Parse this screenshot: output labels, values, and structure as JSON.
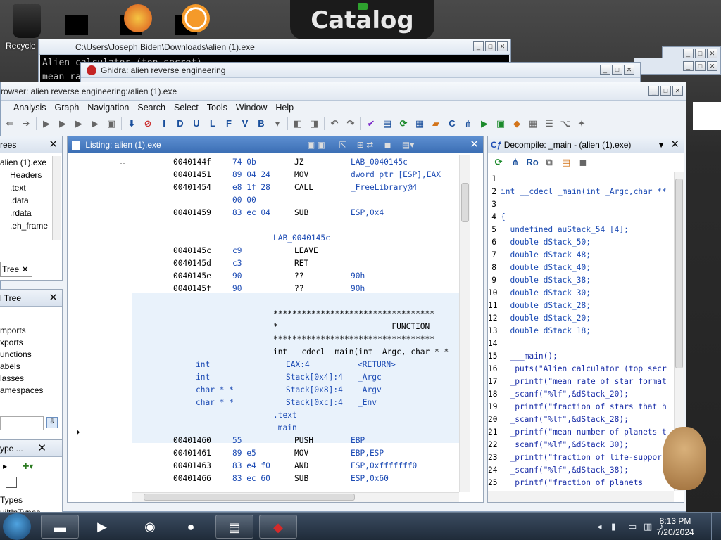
{
  "desktop": {
    "recycle_label": "Recycle",
    "catalog_text": "Catalog"
  },
  "cmd": {
    "title": "C:\\Users\\Joseph Biden\\Downloads\\alien (1).exe",
    "line1": "Alien calculator (top secret)",
    "line2": "mean ra"
  },
  "ghidra_project": {
    "title": "Ghidra: alien reverse engineering"
  },
  "codebrowser": {
    "title": "rowser: alien reverse engineering:/alien (1).exe",
    "menus": [
      "Analysis",
      "Graph",
      "Navigation",
      "Search",
      "Select",
      "Tools",
      "Window",
      "Help"
    ]
  },
  "program_trees": {
    "title": "rees",
    "root": "alien (1).exe",
    "items": [
      "Headers",
      ".text",
      ".data",
      ".rdata",
      ".eh_frame"
    ],
    "tab": "Tree"
  },
  "symbol_tree": {
    "title": "l Tree",
    "items": [
      "mports",
      "xports",
      "unctions",
      "abels",
      "lasses",
      "amespaces"
    ]
  },
  "datatype": {
    "title": "ype ...",
    "items": [
      "Types",
      "uiltInTypes"
    ]
  },
  "listing": {
    "title": "Listing:  alien (1).exe",
    "rows": [
      {
        "addr": "0040144f",
        "bytes": "74 0b",
        "mnem": "JZ",
        "oper": "LAB_0040145c"
      },
      {
        "addr": "00401451",
        "bytes": "89 04 24",
        "mnem": "MOV",
        "oper": "dword ptr [ESP],EAX"
      },
      {
        "addr": "00401454",
        "bytes": "e8 1f 28",
        "mnem": "CALL",
        "oper": "_FreeLibrary@4"
      },
      {
        "addr": "",
        "bytes": "00 00",
        "mnem": "",
        "oper": ""
      },
      {
        "addr": "00401459",
        "bytes": "83 ec 04",
        "mnem": "SUB",
        "oper": "ESP,0x4"
      }
    ],
    "label1": "LAB_0040145c",
    "rows2": [
      {
        "addr": "0040145c",
        "bytes": "c9",
        "mnem": "LEAVE",
        "oper": ""
      },
      {
        "addr": "0040145d",
        "bytes": "c3",
        "mnem": "RET",
        "oper": ""
      },
      {
        "addr": "0040145e",
        "bytes": "90",
        "mnem": "??",
        "oper": "90h"
      },
      {
        "addr": "0040145f",
        "bytes": "90",
        "mnem": "??",
        "oper": "90h"
      }
    ],
    "stars": "**********************************",
    "function_banner": "*                        FUNCTION",
    "signature": "int __cdecl _main(int _Argc, char * *",
    "params": [
      {
        "type": "int",
        "loc": "EAX:4",
        "name": "<RETURN>"
      },
      {
        "type": "int",
        "loc": "Stack[0x4]:4",
        "name": "_Argc"
      },
      {
        "type": "char * *",
        "loc": "Stack[0x8]:4",
        "name": "_Argv"
      },
      {
        "type": "char * *",
        "loc": "Stack[0xc]:4",
        "name": "_Env"
      }
    ],
    "section": ".text",
    "func_label": "_main",
    "rows3": [
      {
        "addr": "00401460",
        "bytes": "55",
        "mnem": "PUSH",
        "oper": "EBP"
      },
      {
        "addr": "00401461",
        "bytes": "89 e5",
        "mnem": "MOV",
        "oper": "EBP,ESP"
      },
      {
        "addr": "00401463",
        "bytes": "83 e4 f0",
        "mnem": "AND",
        "oper": "ESP,0xfffffff0"
      },
      {
        "addr": "00401466",
        "bytes": "83 ec 60",
        "mnem": "SUB",
        "oper": "ESP,0x60"
      }
    ]
  },
  "decompiler": {
    "title": "Decompile: _main - (alien (1).exe)",
    "lines": [
      {
        "n": "1",
        "t": ""
      },
      {
        "n": "2",
        "t": "int __cdecl _main(int _Argc,char **"
      },
      {
        "n": "3",
        "t": ""
      },
      {
        "n": "4",
        "t": "{"
      },
      {
        "n": "5",
        "t": "  undefined auStack_54 [4];"
      },
      {
        "n": "6",
        "t": "  double dStack_50;"
      },
      {
        "n": "7",
        "t": "  double dStack_48;"
      },
      {
        "n": "8",
        "t": "  double dStack_40;"
      },
      {
        "n": "9",
        "t": "  double dStack_38;"
      },
      {
        "n": "10",
        "t": "  double dStack_30;"
      },
      {
        "n": "11",
        "t": "  double dStack_28;"
      },
      {
        "n": "12",
        "t": "  double dStack_20;"
      },
      {
        "n": "13",
        "t": "  double dStack_18;"
      },
      {
        "n": "14",
        "t": ""
      },
      {
        "n": "15",
        "t": "  ___main();"
      },
      {
        "n": "16",
        "t": "  _puts(\"Alien calculator (top secr"
      },
      {
        "n": "17",
        "t": "  _printf(\"mean rate of star format"
      },
      {
        "n": "18",
        "t": "  _scanf(\"%lf\",&dStack_20);"
      },
      {
        "n": "19",
        "t": "  _printf(\"fraction of stars that h"
      },
      {
        "n": "20",
        "t": "  _scanf(\"%lf\",&dStack_28);"
      },
      {
        "n": "21",
        "t": "  _printf(\"mean number of planets t"
      },
      {
        "n": "22",
        "t": "  _scanf(\"%lf\",&dStack_30);"
      },
      {
        "n": "23",
        "t": "  _printf(\"fraction of life-suppor"
      },
      {
        "n": "24",
        "t": "  _scanf(\"%lf\",&dStack_38);"
      },
      {
        "n": "25",
        "t": "  _printf(\"fraction of planets"
      }
    ]
  },
  "taskbar": {
    "time": "8:13 PM",
    "date": "7/20/2024"
  }
}
